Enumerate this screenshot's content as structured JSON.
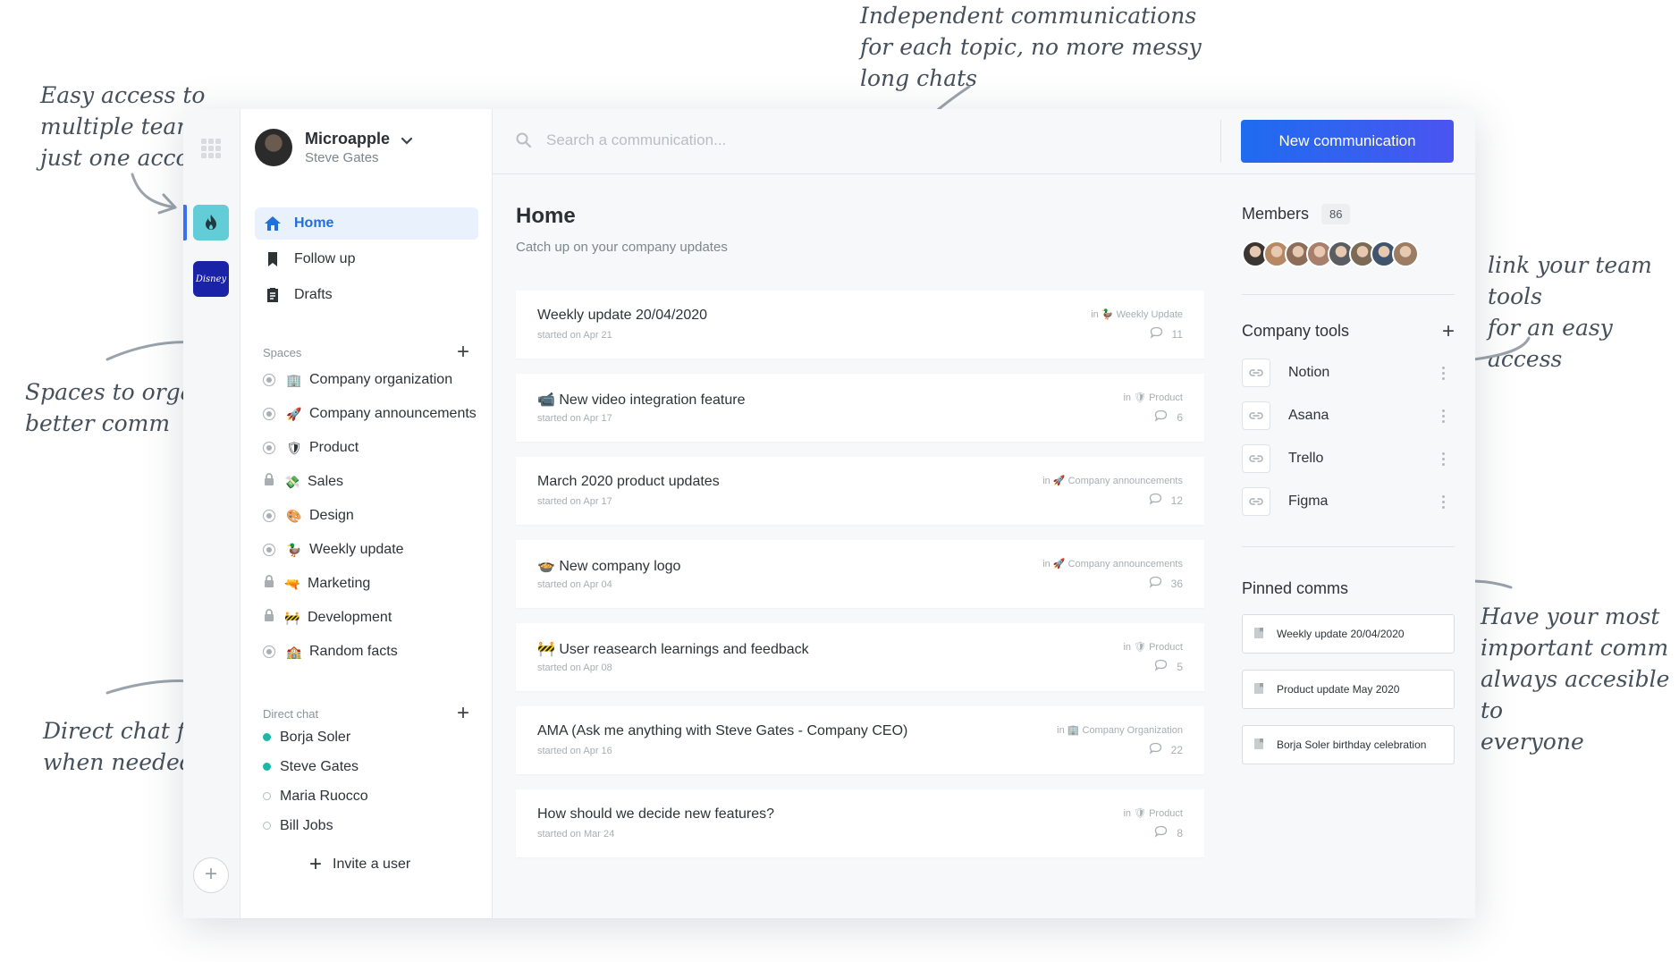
{
  "annotations": {
    "teams": "Easy access to\nmultiple teams in\njust one account",
    "comms": "Independent communications\nfor each topic, no more messy\nlong chats",
    "spaces": "Spaces to organize\nbetter comm",
    "tools": "link your team\ntools\nfor an easy access",
    "chat": "Direct chat for\nwhen needed",
    "pinned": "Have your most\nimportant comm\nalways accesible to\neveryone"
  },
  "rail": {
    "team2_label": "Disney"
  },
  "workspace": {
    "name": "Microapple",
    "user": "Steve Gates"
  },
  "nav": [
    {
      "label": "Home",
      "icon": "home-icon"
    },
    {
      "label": "Follow up",
      "icon": "bookmark-icon"
    },
    {
      "label": "Drafts",
      "icon": "clipboard-icon"
    }
  ],
  "spaces": {
    "heading": "Spaces",
    "add": "+",
    "items": [
      {
        "label": "Company organization",
        "emoji": "🏢",
        "private": false
      },
      {
        "label": "Company announcements",
        "emoji": "🚀",
        "private": false
      },
      {
        "label": "Product",
        "emoji": "🛡",
        "private": false
      },
      {
        "label": "Sales",
        "emoji": "💸",
        "private": true
      },
      {
        "label": "Design",
        "emoji": "🎨",
        "private": false
      },
      {
        "label": "Weekly update",
        "emoji": "🦆",
        "private": false
      },
      {
        "label": "Marketing",
        "emoji": "🔫",
        "private": true
      },
      {
        "label": "Development",
        "emoji": "🚧",
        "private": true
      },
      {
        "label": "Random facts",
        "emoji": "🏫",
        "private": false
      }
    ]
  },
  "direct_chat": {
    "heading": "Direct chat",
    "add": "+",
    "items": [
      {
        "name": "Borja Soler",
        "online": true
      },
      {
        "name": "Steve Gates",
        "online": true
      },
      {
        "name": "Maria Ruocco",
        "online": false
      },
      {
        "name": "Bill Jobs",
        "online": false
      }
    ]
  },
  "invite": {
    "plus": "+",
    "label": "Invite a user"
  },
  "search": {
    "placeholder": "Search a communication..."
  },
  "new_button": "New communication",
  "page": {
    "title": "Home",
    "subtitle": "Catch up on your company updates"
  },
  "communications": [
    {
      "title": "Weekly update 20/04/2020",
      "date": "started on Apr 21",
      "space": "in 🦆 Weekly Update",
      "count": "11"
    },
    {
      "title": "📹 New video integration feature",
      "date": "started on Apr 17",
      "space": "in 🛡 Product",
      "count": "6"
    },
    {
      "title": "March 2020 product updates",
      "date": "started on Apr 17",
      "space": "in 🚀 Company announcements",
      "count": "12"
    },
    {
      "title": "🍲 New company logo",
      "date": "started on Apr 04",
      "space": "in 🚀 Company announcements",
      "count": "36"
    },
    {
      "title": "🚧 User reasearch learnings and feedback",
      "date": "started on Apr 08",
      "space": "in 🛡 Product",
      "count": "5"
    },
    {
      "title": "AMA (Ask me anything with Steve Gates - Company CEO)",
      "date": "started on Apr 16",
      "space": "in 🏢 Company Organization",
      "count": "22"
    },
    {
      "title": "How should we decide new features?",
      "date": "started on Mar 24",
      "space": "in 🛡 Product",
      "count": "8"
    }
  ],
  "members": {
    "heading": "Members",
    "count": "86",
    "avatar_colors": [
      "#3b3632",
      "#b88864",
      "#8c6d5a",
      "#a77f6b",
      "#5a5d62",
      "#7b6a55",
      "#3f556e",
      "#9c7c63"
    ]
  },
  "tools": {
    "heading": "Company tools",
    "add": "+",
    "items": [
      "Notion",
      "Asana",
      "Trello",
      "Figma"
    ]
  },
  "pinned": {
    "heading": "Pinned comms",
    "items": [
      "Weekly update 20/04/2020",
      "Product update May 2020",
      "Borja Soler birthday celebration"
    ]
  },
  "colors": {
    "accent": "#1f6fdc",
    "online": "#1ab8a5",
    "button_start": "#1e6cf0",
    "button_end": "#4a55f0"
  }
}
